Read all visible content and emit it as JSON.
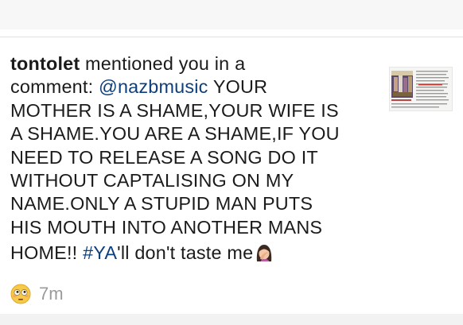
{
  "notification": {
    "username": "tontolet",
    "line1_rest": " mentioned you in a",
    "line2_prefix": "comment: ",
    "mention": "@nazbmusic",
    "line2_rest": " YOUR",
    "line3": "MOTHER IS A SHAME,YOUR WIFE IS",
    "line4": "A SHAME.YOU ARE A SHAME,IF YOU",
    "line5": "NEED TO RELEASE A SONG DO IT",
    "line6": "WITHOUT CAPTALISING ON MY",
    "line7": "NAME.ONLY A STUPID MAN PUTS",
    "line8": "HIS MOUTH INTO ANOTHER MANS",
    "line9_prefix": "HOME!! ",
    "hashtag": "#YA",
    "line9_rest": "'ll don't taste me",
    "emoji_end": "woman-facepalming-emoji",
    "reaction_emoji": "flushed-face-emoji",
    "time": "7m"
  },
  "colors": {
    "link": "#0d3f7c",
    "text": "#1b1b1b",
    "timestamp": "#9a9a9a"
  }
}
